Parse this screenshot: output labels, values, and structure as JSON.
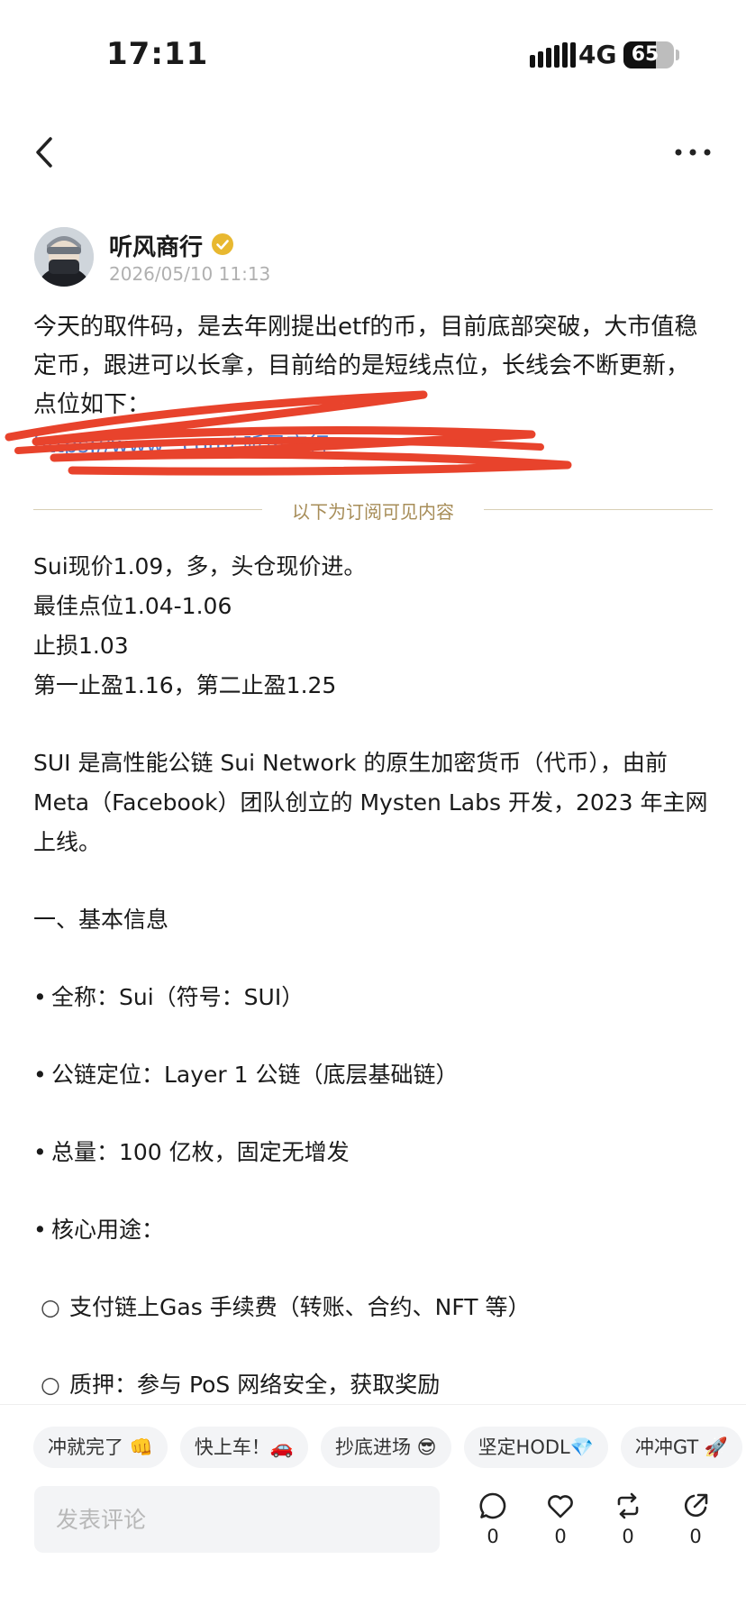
{
  "status_bar": {
    "time": "17:11",
    "network": "4G",
    "battery_level": 0.65,
    "battery_text": "65"
  },
  "nav": {
    "back_icon": "chevron-left-icon",
    "more_icon": "ellipsis-horizontal-icon"
  },
  "author": {
    "name": "听风商行",
    "date": "2026/05/10 11:13",
    "verified_icon": "verified-badge-icon",
    "verified_color": "#e8b830"
  },
  "post": {
    "intro": "今天的取件码，是去年刚提出etf的币，目前底部突破，大市值稳定币，跟进可以长拿，目前给的是短线点位，长线会不断更新，点位如下：",
    "redacted_link": "https://www.      .com/        听风商行",
    "redaction_color": "#e8432c",
    "paywall_divider": "以下为订阅可见内容",
    "lines": [
      "Sui现价1.09，多，头仓现价进。",
      "最佳点位1.04-1.06",
      "止损1.03",
      "第一止盈1.16，第二止盈1.25"
    ],
    "description": "SUI 是高性能公链 Sui Network 的原生加密货币（代币），由前 Meta（Facebook）团队创立的 Mysten Labs 开发，2023 年主网上线。",
    "section_title": "一、基本信息",
    "bullets": [
      "全称：Sui（符号：SUI）",
      "公链定位：Layer 1 公链（底层基础链）",
      "总量：100 亿枚，固定无增发",
      "核心用途："
    ],
    "sub_bullets": [
      "支付链上Gas 手续费（转账、合约、NFT 等）",
      "质押：参与 PoS 网络安全，获取奖励"
    ]
  },
  "quick_replies": [
    "冲就完了 👊",
    "快上车！🚗",
    "抄底进场 😎",
    "坚定HODL💎",
    "冲冲GT 🚀"
  ],
  "comment": {
    "placeholder": "发表评论"
  },
  "actions": {
    "comment_count": "0",
    "like_count": "0",
    "repost_count": "0",
    "share_count": "0"
  }
}
